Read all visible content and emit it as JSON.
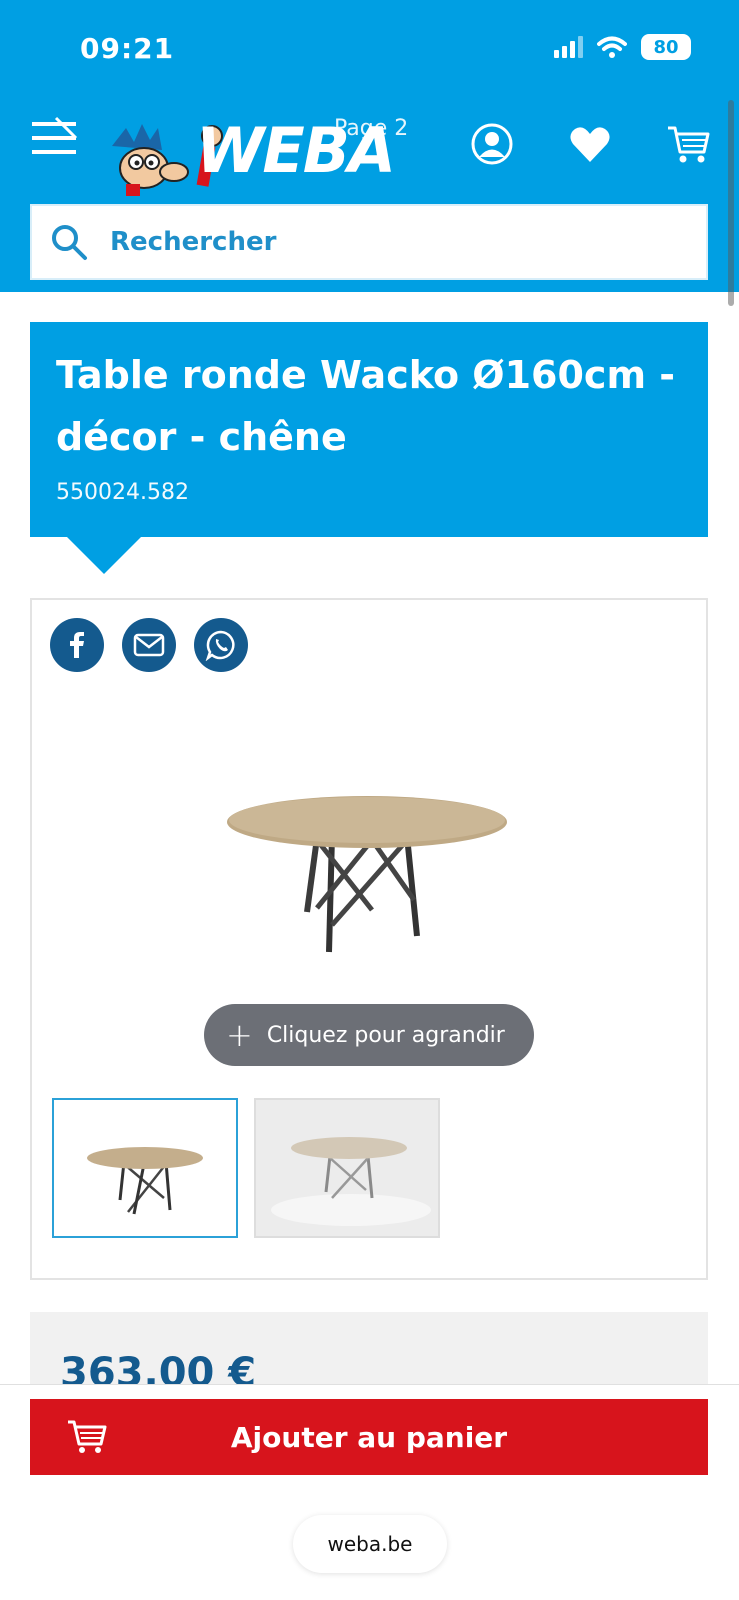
{
  "status_bar": {
    "time": "09:21",
    "battery": "80"
  },
  "header": {
    "logo_text": "WEBA",
    "tab_hint": "Page 2",
    "search": {
      "placeholder": "Rechercher"
    },
    "icons": [
      "menu-icon",
      "account-icon",
      "heart-icon",
      "cart-icon"
    ]
  },
  "product": {
    "title": "Table ronde Wacko Ø160cm - décor - chêne",
    "sku": "550024.582",
    "price": "363,00 €"
  },
  "gallery": {
    "share_icons": [
      "facebook-icon",
      "mail-icon",
      "whatsapp-icon"
    ],
    "zoom_label": "Cliquez pour agrandir",
    "zoom_symbol": "+",
    "thumbnails_count": 2
  },
  "actions": {
    "add_to_cart": "Ajouter au panier"
  },
  "browser": {
    "url": "weba.be"
  },
  "colors": {
    "brand_blue": "#009fe3",
    "dark_blue": "#145a8e",
    "cta_red": "#d7141c",
    "pill_gray": "#6c6f76"
  }
}
